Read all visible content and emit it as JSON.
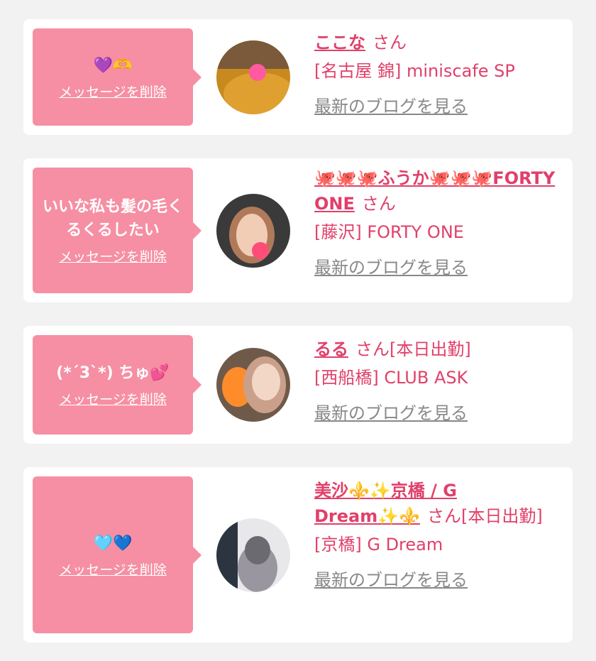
{
  "cards": [
    {
      "message": "💜🫶",
      "delete_label": "メッセージを削除",
      "name": "ここな",
      "san": "さん",
      "status": "",
      "shop": "[名古屋 錦] miniscafe SP",
      "blog_label": "最新のブログを見る"
    },
    {
      "message": "いいな私も髪の毛くるくるしたい",
      "delete_label": "メッセージを削除",
      "name": "🐙🐙🐙ふうか🐙🐙🐙FORTY ONE",
      "san": "さん",
      "status": "",
      "shop": "[藤沢] FORTY ONE",
      "blog_label": "最新のブログを見る"
    },
    {
      "message": "(*´3`*) ちゅ💕",
      "delete_label": "メッセージを削除",
      "name": "るる",
      "san": "さん",
      "status": "[本日出勤]",
      "shop": "[西船橋] CLUB ASK",
      "blog_label": "最新のブログを見る"
    },
    {
      "message": "🩵💙",
      "delete_label": "メッセージを削除",
      "name": "美沙⚜️✨京橋 / G Dream✨⚜️",
      "san": "さん",
      "status": "[本日出勤]",
      "shop": "[京橋] G Dream",
      "blog_label": "最新のブログを見る"
    }
  ],
  "colors": {
    "page_bg": "#f2f2f2",
    "bubble": "#f68fa3",
    "accent": "#e0406a",
    "muted": "#888888"
  }
}
